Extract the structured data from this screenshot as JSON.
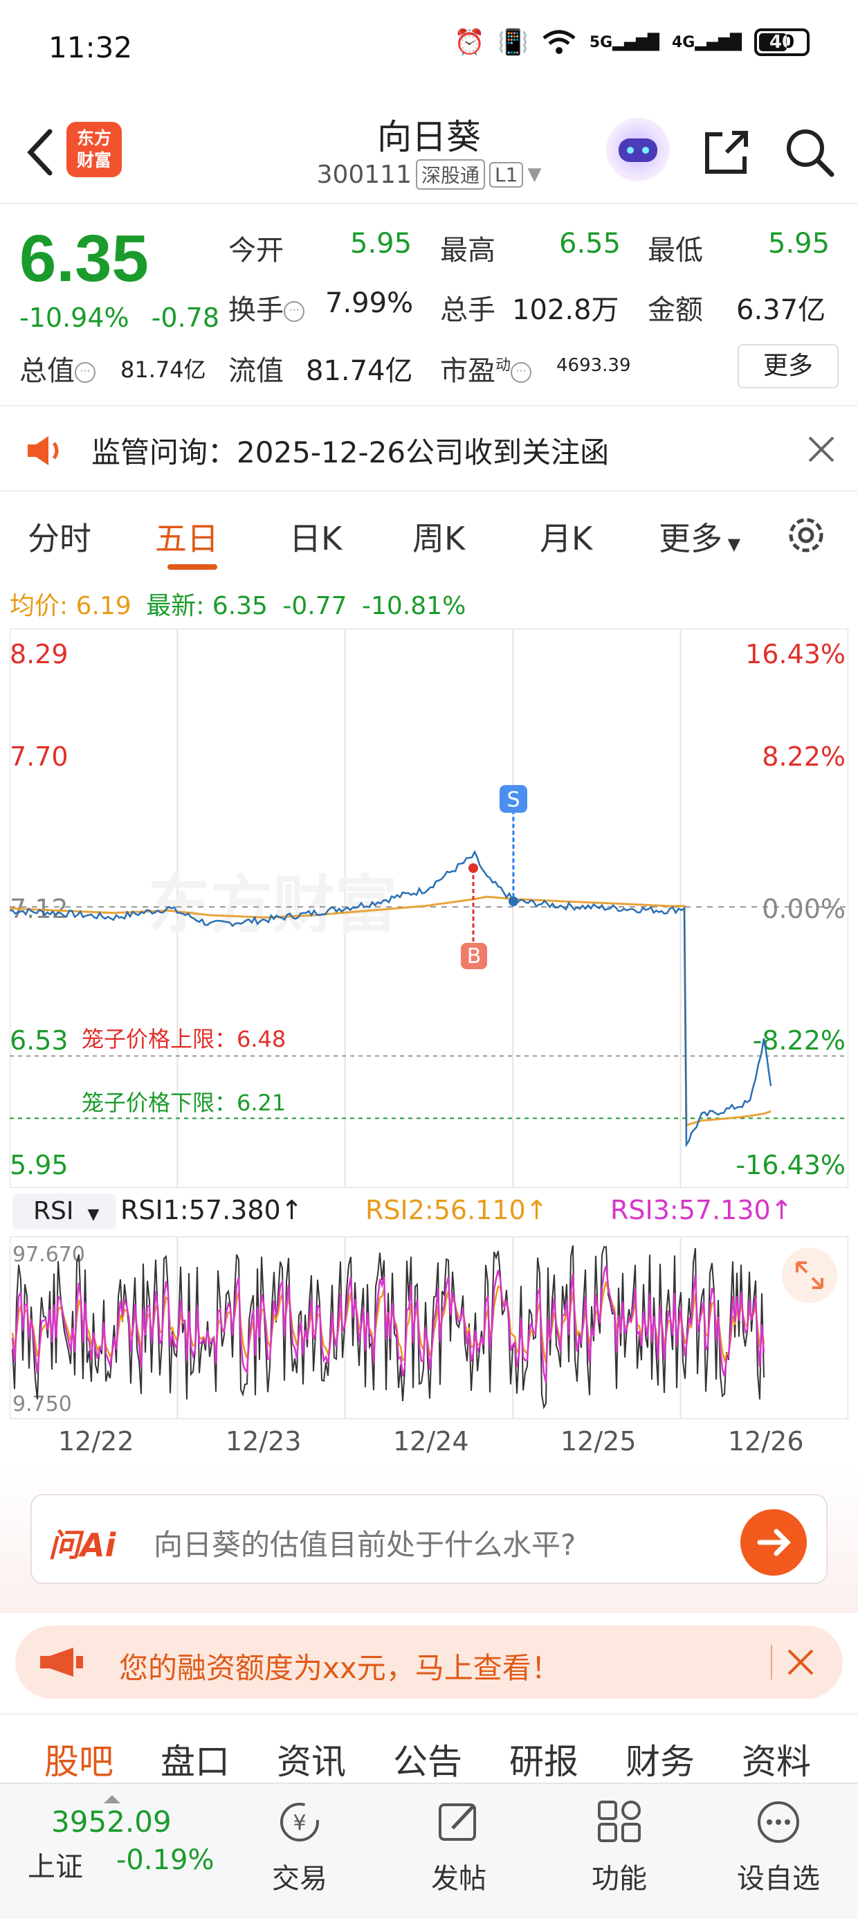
{
  "status_bar": {
    "time": "11:32",
    "net1": "5G",
    "net2": "4G",
    "battery": "40"
  },
  "header": {
    "logo_line1": "东方",
    "logo_line2": "财富",
    "stock_name": "向日葵",
    "stock_code": "300111",
    "tag": "深股通",
    "level": "L1"
  },
  "quote": {
    "price": "6.35",
    "change_pct": "-10.94%",
    "change_amt": "-0.78",
    "open_label": "今开",
    "open": "5.95",
    "high_label": "最高",
    "high": "6.55",
    "low_label": "最低",
    "low": "5.95",
    "turnover_label": "换手",
    "turnover": "7.99%",
    "volume_label": "总手",
    "volume": "102.8万",
    "amount_label": "金额",
    "amount": "6.37亿",
    "mktcap_label": "总值",
    "mktcap": "81.74亿",
    "float_label": "流值",
    "float": "81.74亿",
    "pe_label": "市盈",
    "pe_sup": "动",
    "pe": "4693.39",
    "more": "更多"
  },
  "notice": {
    "text": "监管问询：2025-12-26公司收到关注函"
  },
  "tabs": [
    "分时",
    "五日",
    "日K",
    "周K",
    "月K",
    "更多"
  ],
  "avg_line": {
    "avg_label": "均价:",
    "avg": "6.19",
    "latest_label": "最新:",
    "latest": "6.35",
    "chg": "-0.77",
    "pct": "-10.81%"
  },
  "chart_data": {
    "type": "line",
    "y_left_labels": [
      "8.29",
      "7.70",
      "7.12",
      "6.53",
      "5.95"
    ],
    "y_right_labels": [
      "16.43%",
      "8.22%",
      "0.00%",
      "-8.22%",
      "-16.43%"
    ],
    "ylim": [
      5.95,
      8.29
    ],
    "ref_price": "7.12",
    "cage_upper_label": "笼子价格上限：6.48",
    "cage_lower_label": "笼子价格下限：6.21",
    "cage_upper": 6.48,
    "cage_lower": 6.21,
    "marker_buy": "B",
    "marker_sell": "S",
    "watermark": "东方财富",
    "x": [
      "12/22",
      "12/23",
      "12/24",
      "12/25",
      "12/26"
    ],
    "series": [
      {
        "values": [
          7.11,
          7.1,
          7.08,
          7.12,
          7.05,
          7.07,
          7.1,
          7.14,
          7.2,
          7.35,
          7.25,
          7.15,
          7.13,
          7.12,
          7.11,
          7.12,
          6.1,
          6.22,
          6.25,
          6.28,
          6.55,
          6.35
        ]
      },
      {
        "values": [
          7.12,
          7.11,
          7.1,
          7.11,
          7.09,
          7.08,
          7.09,
          7.11,
          7.13,
          7.16,
          7.17,
          7.16,
          7.15,
          7.14,
          7.13,
          7.13,
          6.18,
          6.2,
          6.21,
          6.22,
          6.23,
          6.24
        ]
      }
    ]
  },
  "rsi": {
    "select": "RSI",
    "rsi1": "RSI1:57.380↑",
    "rsi2": "RSI2:56.110↑",
    "rsi3": "RSI3:57.130↑",
    "max": "97.670",
    "min": "9.750",
    "colors": {
      "rsi1": "#333333",
      "rsi2": "#e89b1a",
      "rsi3": "#d635c9"
    }
  },
  "ai": {
    "logo": "问Ai",
    "question": "向日葵的估值目前处于什么水平?"
  },
  "promo": {
    "text": "您的融资额度为xx元，马上查看！"
  },
  "bottom_tabs": [
    "股吧",
    "盘口",
    "资讯",
    "公告",
    "研报",
    "财务",
    "资料"
  ],
  "bottom_nav": {
    "index_value": "3952.09",
    "index_name": "上证",
    "index_chg": "-0.19%",
    "items": [
      "交易",
      "发帖",
      "功能",
      "设自选"
    ]
  },
  "colors": {
    "up": "#e0302a",
    "down": "#1a9b2b",
    "accent": "#e05a18",
    "line": "#2a6fb3",
    "avg": "#e8a33a"
  }
}
